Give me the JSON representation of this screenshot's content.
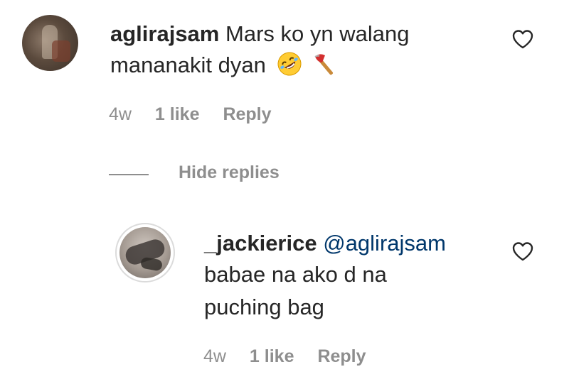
{
  "comment": {
    "username": "aglirajsam",
    "text_line1": "Mars ko yn walang",
    "text_line2": "mananakit dyan",
    "emojis": [
      "rolling-on-floor-laughing-emoji",
      "axe-emoji"
    ],
    "age": "4w",
    "likes": "1 like",
    "reply_label": "Reply",
    "like_icon": "heart-outline-icon"
  },
  "replies_toggle": {
    "label": "Hide replies"
  },
  "reply": {
    "username": "_jackierice",
    "mention": "@aglirajsam",
    "text_line1": "babae na ako d na",
    "text_line2": "puching bag",
    "age": "4w",
    "likes": "1 like",
    "reply_label": "Reply",
    "like_icon": "heart-outline-icon"
  },
  "colors": {
    "text": "#262626",
    "secondary": "#8e8e8e",
    "mention": "#00376b",
    "background": "#ffffff"
  }
}
